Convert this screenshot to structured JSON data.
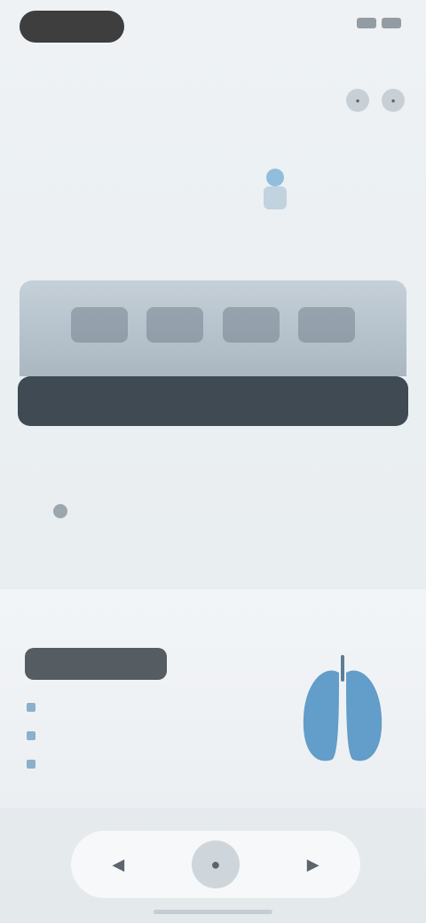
{
  "status_bar": {
    "pill_text": "",
    "right_text": "",
    "icons": [
      "signal-icon",
      "battery-icon"
    ]
  },
  "header": {
    "title": "",
    "subtitle": "",
    "actions": [
      {
        "icon": "bell-icon",
        "glyph": "•"
      },
      {
        "icon": "profile-icon",
        "glyph": "•"
      }
    ]
  },
  "date_strip": {
    "items": [
      {
        "label": ""
      },
      {
        "label": ""
      },
      {
        "label": ""
      },
      {
        "label": ""
      },
      {
        "label": "",
        "active": true
      },
      {
        "label": ""
      },
      {
        "label": ""
      }
    ]
  },
  "section": {
    "title": ""
  },
  "hero": {
    "stats": [
      "",
      "",
      "",
      ""
    ],
    "button_label": ""
  },
  "options": {
    "label": "",
    "chips": [
      {
        "label": "",
        "icon": "sensor-icon"
      },
      {
        "label": ""
      }
    ],
    "hint": ""
  },
  "product": {
    "label": "",
    "right_label": "",
    "badge": "",
    "price": "",
    "features": [
      "",
      "",
      ""
    ],
    "image_icon": "lungs-icon"
  },
  "bottom_nav": {
    "label": "",
    "items": [
      {
        "icon": "back-icon",
        "glyph": "◀"
      },
      {
        "icon": "home-icon",
        "glyph": "●"
      },
      {
        "icon": "forward-icon",
        "glyph": "▶"
      }
    ]
  },
  "colors": {
    "accent": "#4b7fa6",
    "dark_button": "#3f4a53",
    "lung_blue": "#4a8ec2"
  }
}
